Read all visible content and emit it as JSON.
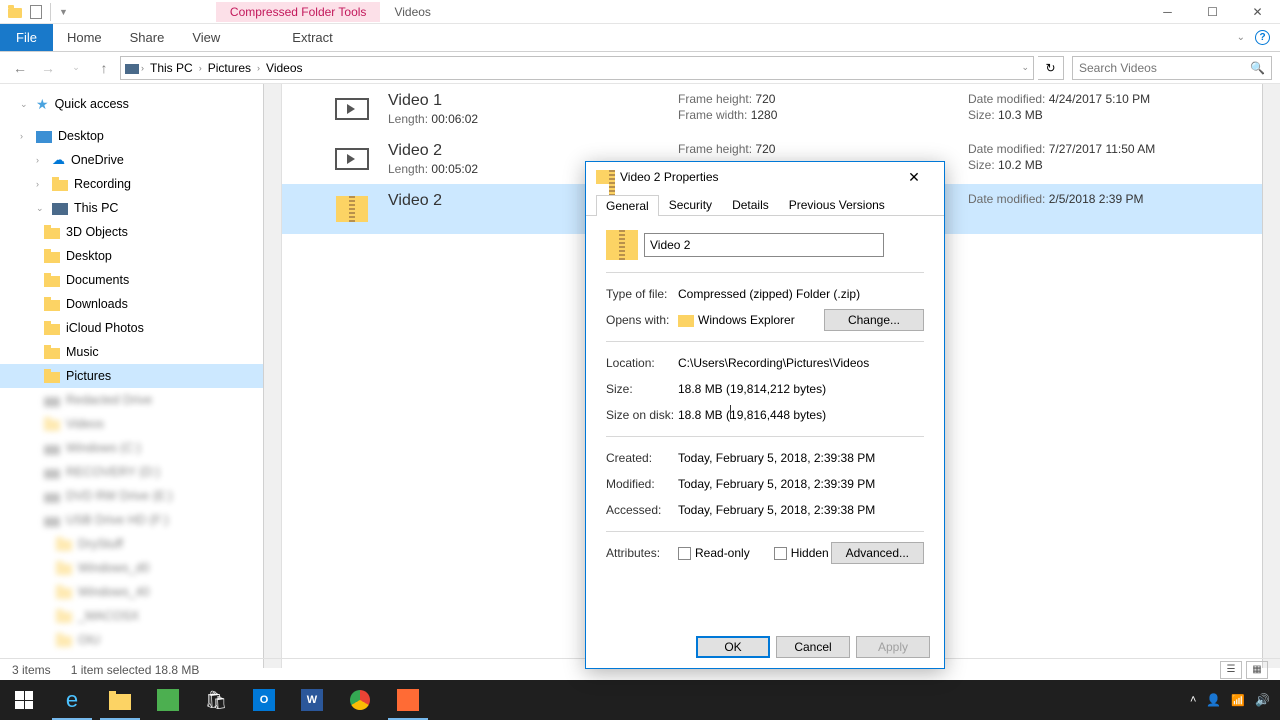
{
  "titlebar": {
    "toolTab": "Compressed Folder Tools",
    "titleTab": "Videos"
  },
  "ribbon": {
    "file": "File",
    "home": "Home",
    "share": "Share",
    "view": "View",
    "extract": "Extract"
  },
  "breadcrumbs": {
    "c0": "This PC",
    "c1": "Pictures",
    "c2": "Videos"
  },
  "search": {
    "placeholder": "Search Videos"
  },
  "sidebar": {
    "quickAccess": "Quick access",
    "desktop": "Desktop",
    "onedrive": "OneDrive",
    "recording": "Recording",
    "thisPC": "This PC",
    "objects3d": "3D Objects",
    "desktop2": "Desktop",
    "documents": "Documents",
    "downloads": "Downloads",
    "icloud": "iCloud Photos",
    "music": "Music",
    "pictures": "Pictures"
  },
  "files": [
    {
      "name": "Video 1",
      "length_k": "Length:",
      "length_v": "00:06:02",
      "fh_k": "Frame height:",
      "fh_v": "720",
      "fw_k": "Frame width:",
      "fw_v": "1280",
      "dm_k": "Date modified:",
      "dm_v": "4/24/2017 5:10 PM",
      "sz_k": "Size:",
      "sz_v": "10.3 MB"
    },
    {
      "name": "Video 2",
      "length_k": "Length:",
      "length_v": "00:05:02",
      "fh_k": "Frame height:",
      "fh_v": "720",
      "dm_k": "Date modified:",
      "dm_v": "7/27/2017 11:50 AM",
      "sz_k": "Size:",
      "sz_v": "10.2 MB"
    },
    {
      "name": "Video 2",
      "dm_k": "Date modified:",
      "dm_v": "2/5/2018 2:39 PM"
    }
  ],
  "dialog": {
    "title": "Video 2 Properties",
    "tabs": {
      "general": "General",
      "security": "Security",
      "details": "Details",
      "previous": "Previous Versions"
    },
    "nameValue": "Video 2",
    "typeLabel": "Type of file:",
    "typeValue": "Compressed (zipped) Folder (.zip)",
    "opensLabel": "Opens with:",
    "opensValue": "Windows Explorer",
    "changeBtn": "Change...",
    "locLabel": "Location:",
    "locValue": "C:\\Users\\Recording\\Pictures\\Videos",
    "sizeLabel": "Size:",
    "sizeValue": "18.8 MB (19,814,212 bytes)",
    "diskLabel": "Size on disk:",
    "diskValue": "18.8 MB (19,816,448 bytes)",
    "createdLabel": "Created:",
    "createdValue": "Today, February 5, 2018, 2:39:38 PM",
    "modLabel": "Modified:",
    "modValue": "Today, February 5, 2018, 2:39:39 PM",
    "accLabel": "Accessed:",
    "accValue": "Today, February 5, 2018, 2:39:38 PM",
    "attrLabel": "Attributes:",
    "readonly": "Read-only",
    "hidden": "Hidden",
    "advanced": "Advanced...",
    "ok": "OK",
    "cancel": "Cancel",
    "apply": "Apply"
  },
  "status": {
    "items": "3 items",
    "selected": "1 item selected  18.8 MB"
  }
}
